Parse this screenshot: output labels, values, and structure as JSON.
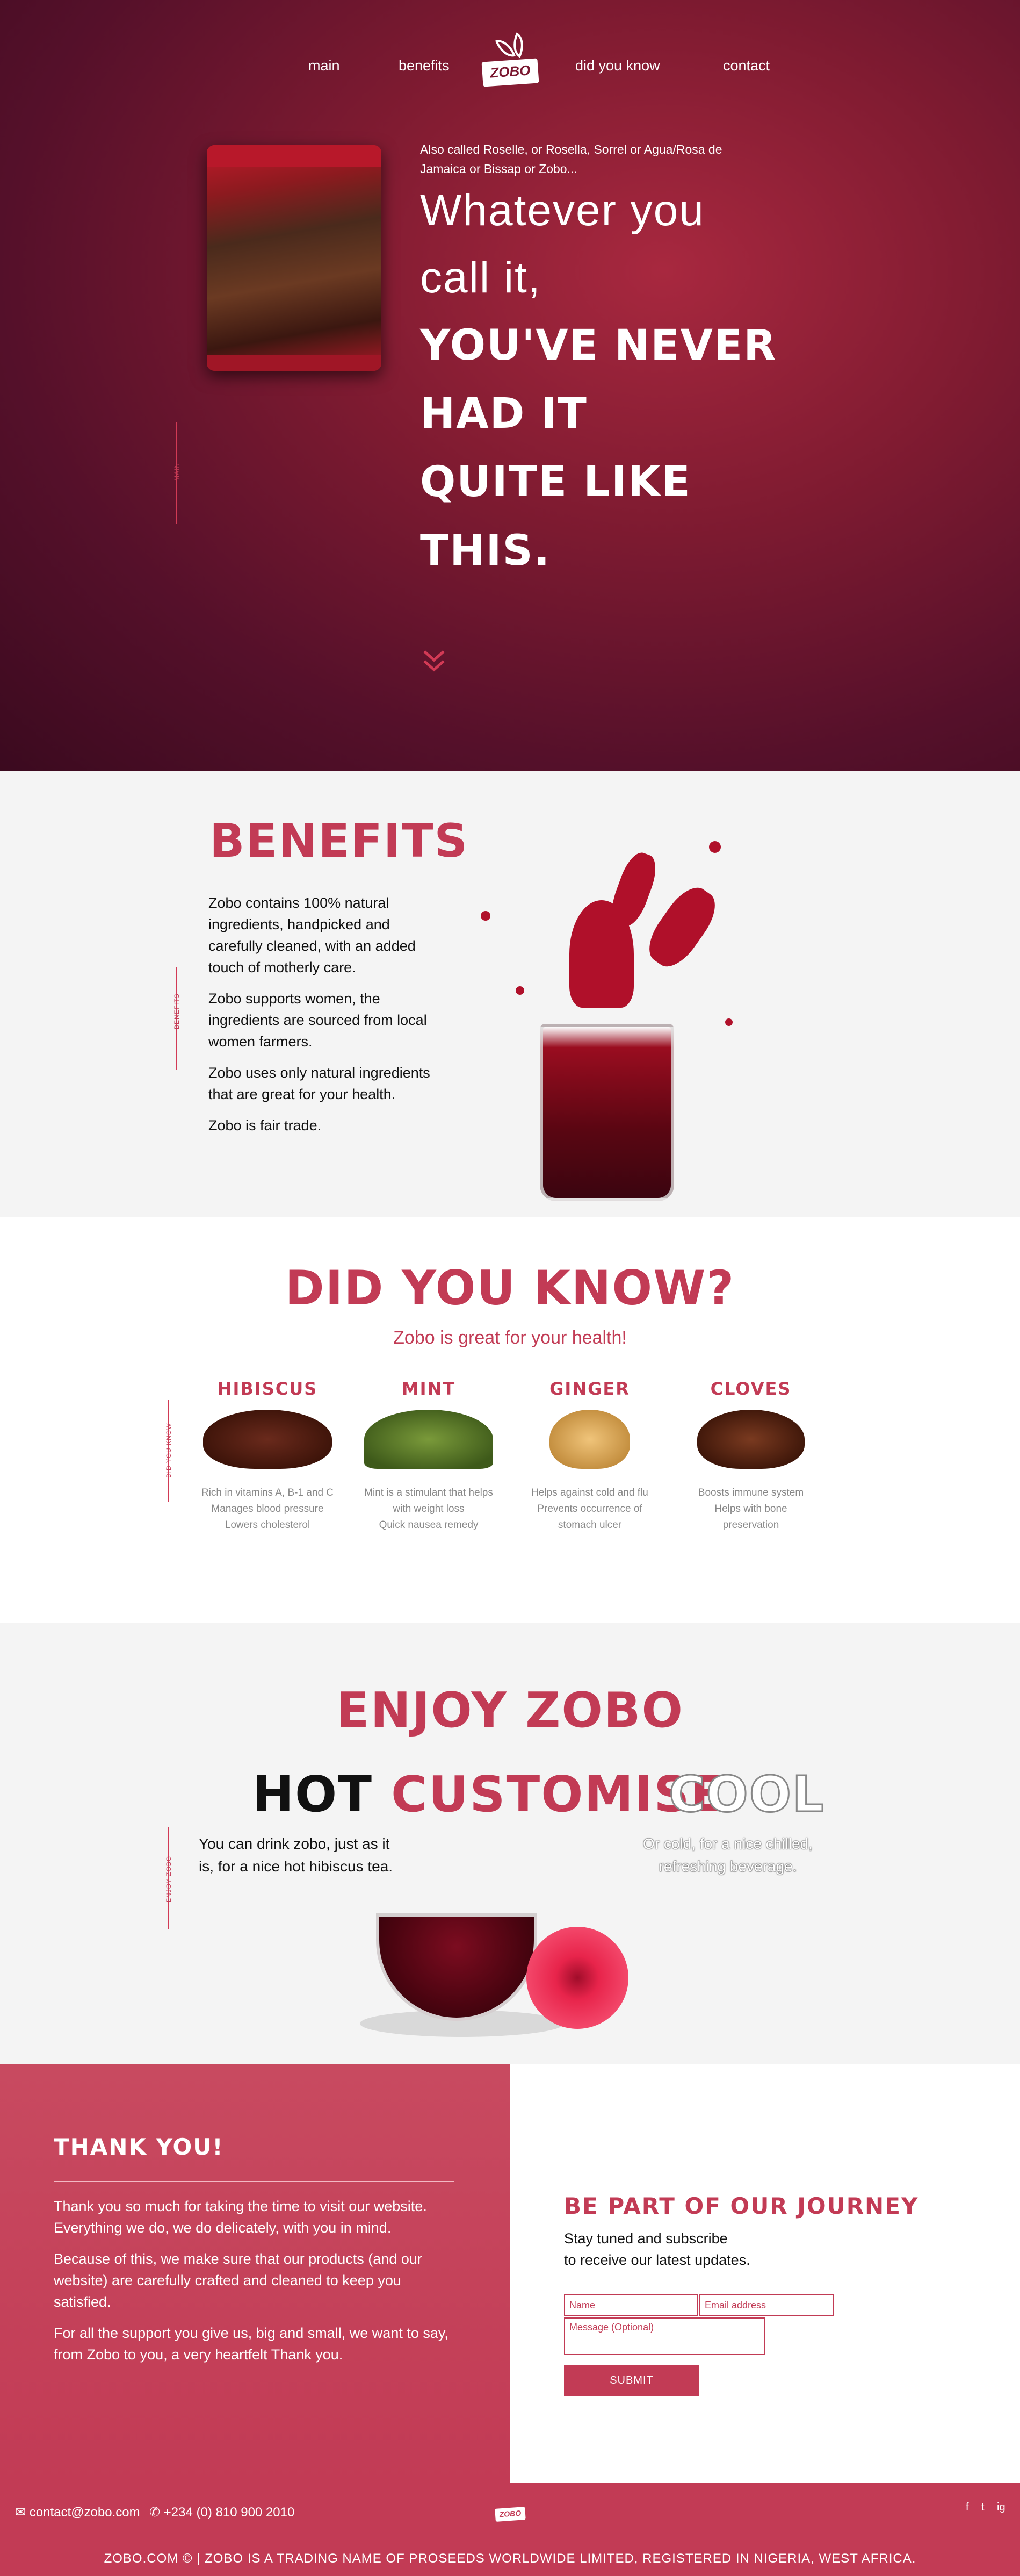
{
  "nav": {
    "items": [
      "main",
      "benefits",
      "did you know",
      "contact"
    ],
    "logo_text": "ZOBO"
  },
  "hero": {
    "side_label": "MAIN",
    "intro": "Also called Roselle, or Rosella, Sorrel or Agua/Rosa de Jamaica or Bissap or Zobo...",
    "line1": "Whatever you",
    "line2": "call it,",
    "bold1": "YOU'VE NEVER",
    "bold2": "HAD IT",
    "bold3": "QUITE LIKE",
    "bold4": "THIS."
  },
  "benefits": {
    "side_label": "BENEFITS",
    "title": "BENEFITS",
    "paragraphs": [
      "Zobo contains 100% natural ingredients, handpicked and carefully cleaned, with an added touch of motherly care.",
      "Zobo supports women, the ingredients are sourced from local women farmers.",
      "Zobo uses only natural ingredients that are great for your health.",
      "Zobo is fair trade."
    ]
  },
  "did_you_know": {
    "side_label": "DID YOU KNOW",
    "title": "DID YOU KNOW?",
    "subtitle": "Zobo is great for your health!",
    "herbs": [
      {
        "name": "HIBISCUS",
        "lines": [
          "Rich in vitamins A, B-1 and C",
          "Manages blood pressure",
          "Lowers cholesterol"
        ],
        "color": "#4a1e14"
      },
      {
        "name": "MINT",
        "lines": [
          "Mint is a stimulant that helps",
          "with weight loss",
          "Quick nausea remedy"
        ],
        "color": "#5a7a2a"
      },
      {
        "name": "GINGER",
        "lines": [
          "Helps against cold and flu",
          "Prevents occurrence of",
          "stomach ulcer"
        ],
        "color": "#d8a555"
      },
      {
        "name": "CLOVES",
        "lines": [
          "Boosts immune system",
          "Helps with bone",
          "preservation"
        ],
        "color": "#5a2a18"
      }
    ]
  },
  "enjoy": {
    "side_label": "ENJOY ZOBO",
    "title": "ENJOY ZOBO",
    "hot": "HOT",
    "customise": "CUSTOMISE",
    "cool": "COOL",
    "hot_text": "You can drink zobo, just as it is, for a nice hot hibiscus tea.",
    "cool_text": "Or cold, for a nice chilled, refreshing beverage."
  },
  "thanks": {
    "title": "THANK YOU!",
    "paragraphs": [
      "Thank you so much for taking the time to visit our website. Everything we do, we do delicately, with you in mind.",
      "Because of this, we make sure that our products (and our website) are carefully crafted and cleaned to keep you satisfied.",
      "For all the support you give us, big and small, we want to say, from Zobo to you, a very heartfelt Thank you."
    ]
  },
  "journey": {
    "title": "BE PART OF OUR JOURNEY",
    "text_line1": "Stay tuned and subscribe",
    "text_line2": "to receive our latest updates.",
    "name_placeholder": "Name",
    "email_placeholder": "Email address",
    "message_placeholder": "Message (Optional)",
    "submit_label": "SUBMIT"
  },
  "footer": {
    "email": "contact@zobo.com",
    "phone": "+234 (0) 810 900 2010",
    "logo_text": "ZOBO",
    "social": [
      "f",
      "t",
      "ig"
    ],
    "copyright": "ZOBO.COM © | ZOBO IS A TRADING NAME OF PROSEEDS WORLDWIDE LIMITED, REGISTERED IN NIGERIA, WEST AFRICA."
  },
  "colors": {
    "accent": "#c23b55",
    "hero_dark": "#3b0a1f",
    "hero_light": "#a8283f"
  }
}
